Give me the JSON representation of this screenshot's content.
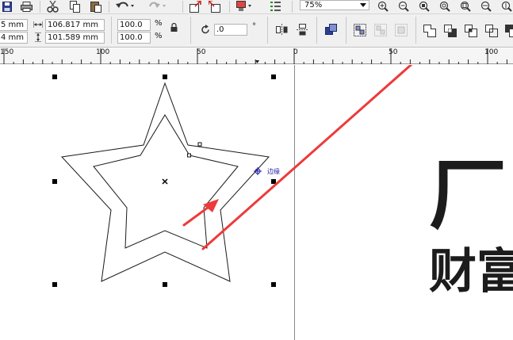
{
  "toolbar_standard": {
    "icons": [
      "save-icon",
      "print-icon",
      "cut-icon",
      "copy-icon",
      "paste-icon",
      "undo-icon",
      "redo-icon",
      "import-icon",
      "export-icon",
      "publish-icon",
      "application-launcher-icon"
    ],
    "zoom_level": "75%",
    "zoom_tools": [
      "zoom-in-icon",
      "zoom-out-icon",
      "zoom-selected-icon",
      "zoom-all-icon",
      "zoom-page-icon",
      "zoom-width-icon"
    ]
  },
  "property_bar": {
    "pos_x_partial": "5 mm",
    "pos_y_partial": "4 mm",
    "width_value": "106.817 mm",
    "height_value": "101.589 mm",
    "scale_x": "100.0",
    "scale_y": "100.0",
    "percent_symbol": "%",
    "rotation_value": ".0",
    "degree_symbol": "°"
  },
  "ruler": {
    "labels": [
      "150",
      "100",
      "50",
      "0",
      "50",
      "100"
    ]
  },
  "canvas": {
    "node_label": "边缘",
    "text_line_1": "厂",
    "text_line_2": "财富"
  },
  "colors": {
    "annotation_arrow": "#ee3a3a",
    "selection_handles": "#000000",
    "node_label": "#1a1aa6",
    "toolbar_bg": "#f0f0f0"
  }
}
